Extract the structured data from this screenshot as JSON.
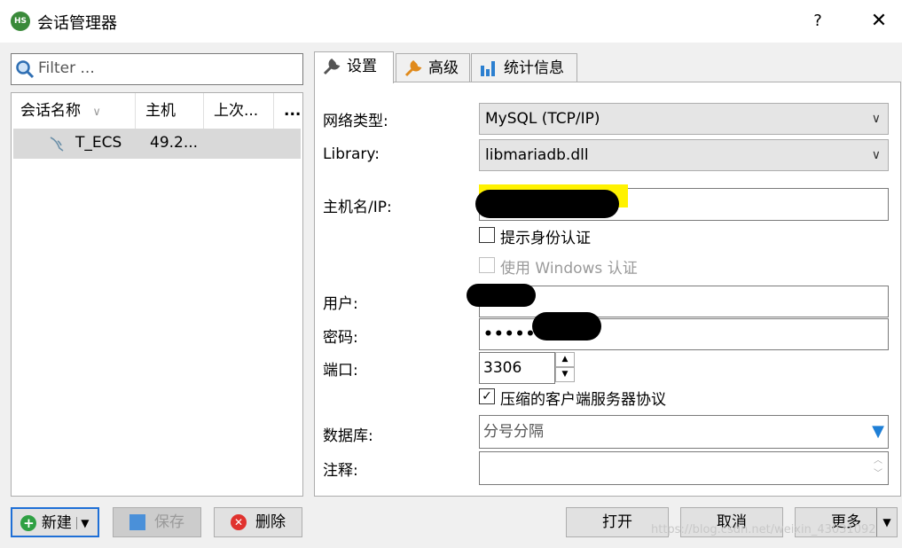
{
  "window": {
    "title": "会话管理器",
    "help_label": "?",
    "close_label": "✕"
  },
  "left": {
    "filter_placeholder": "Filter ...",
    "columns": [
      "会话名称",
      "主机",
      "上次...",
      "..."
    ],
    "sessions": [
      {
        "name": "T_ECS",
        "host": "49.2..."
      }
    ]
  },
  "tabs": [
    {
      "label": "设置"
    },
    {
      "label": "高级"
    },
    {
      "label": "统计信息"
    }
  ],
  "settings": {
    "network_type_label": "网络类型:",
    "network_type_value": "MySQL (TCP/IP)",
    "library_label": "Library:",
    "library_value": "libmariadb.dll",
    "host_label": "主机名/IP:",
    "prompt_auth_label": "提示身份认证",
    "windows_auth_label": "使用 Windows 认证",
    "user_label": "用户:",
    "password_label": "密码:",
    "password_value": "•••••",
    "port_label": "端口:",
    "port_value": "3306",
    "compress_label": "压缩的客户端服务器协议",
    "database_label": "数据库:",
    "database_placeholder": "分号分隔",
    "comment_label": "注释:"
  },
  "buttons": {
    "new": "新建",
    "save": "保存",
    "delete": "删除",
    "open": "打开",
    "cancel": "取消",
    "more": "更多"
  },
  "watermark": "https://blog.csdn.net/weixin_43031092"
}
